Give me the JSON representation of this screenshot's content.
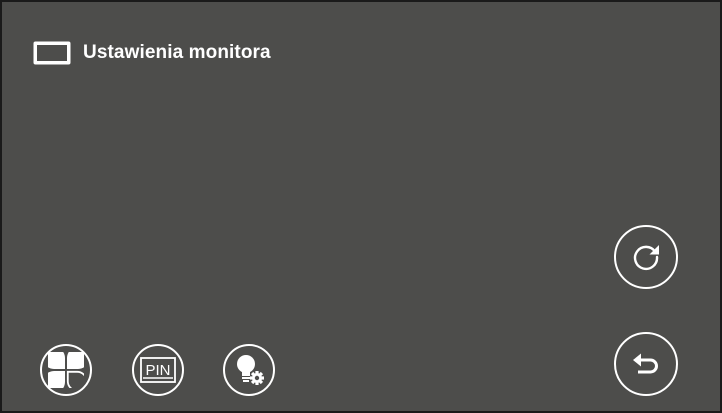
{
  "header": {
    "icon": "monitor-icon",
    "title": "Ustawienia monitora"
  },
  "buttons": {
    "theme": {
      "icon": "theme-petals-icon"
    },
    "pin": {
      "icon": "pin-icon",
      "label": "PIN"
    },
    "light": {
      "icon": "bulb-gear-icon"
    },
    "refresh": {
      "icon": "refresh-icon"
    },
    "back": {
      "icon": "back-arrow-icon"
    }
  },
  "colors": {
    "background": "#4d4d4b",
    "foreground": "#ffffff",
    "frame": "#1a1a1a"
  }
}
